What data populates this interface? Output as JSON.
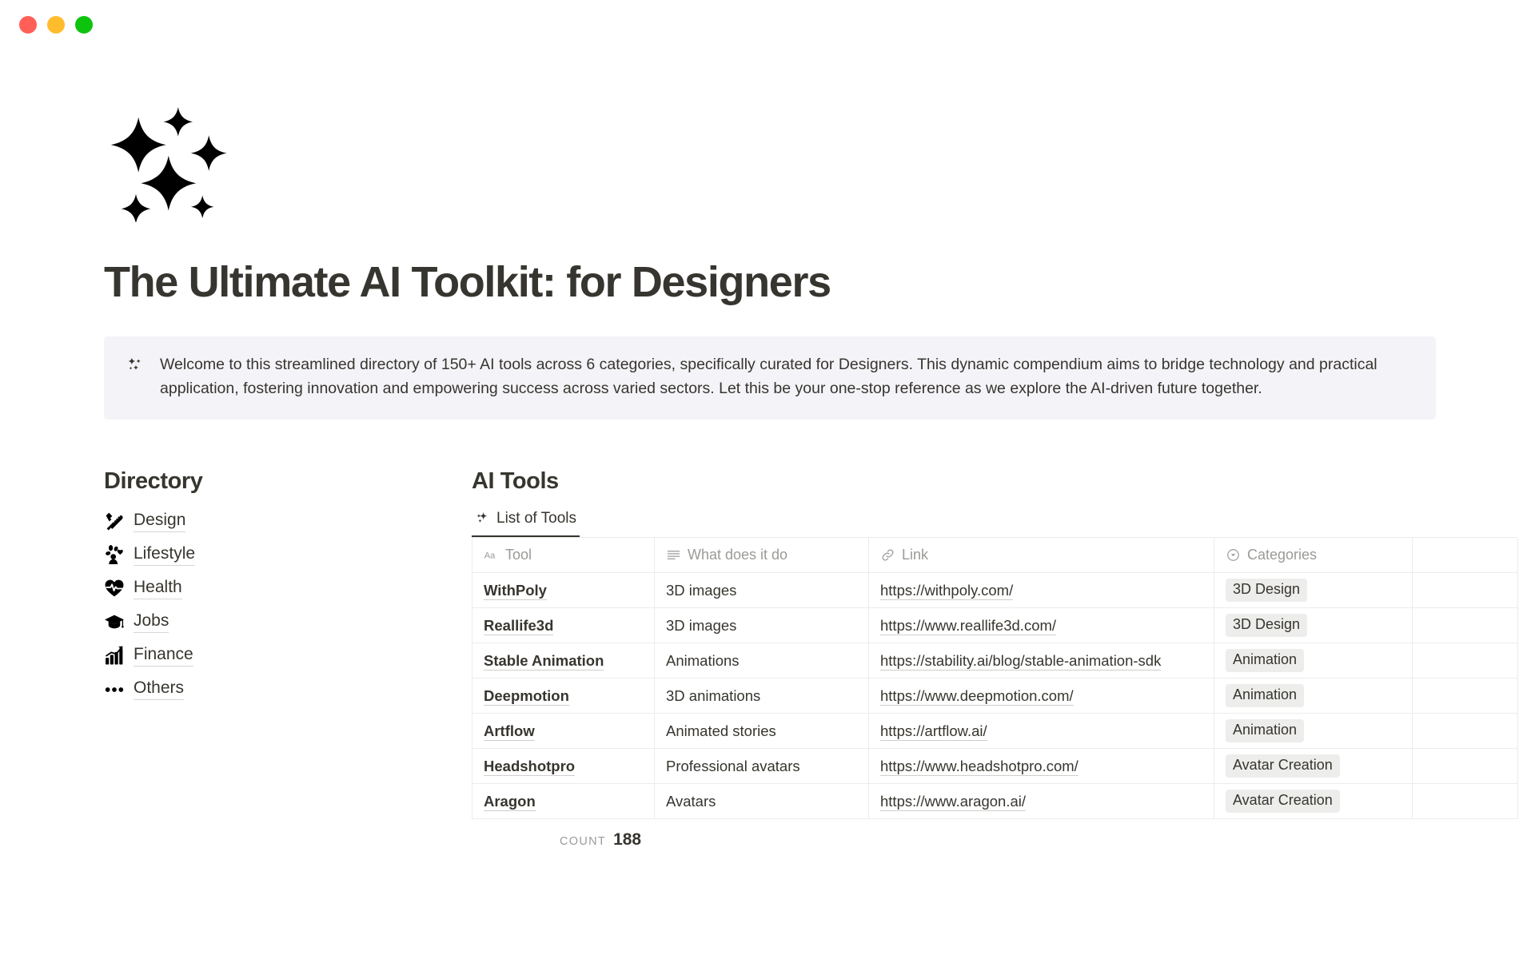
{
  "window": {
    "traffic_lights": [
      {
        "name": "close",
        "color": "#ff5f57"
      },
      {
        "name": "minimize",
        "color": "#ffbd2e"
      },
      {
        "name": "maximize",
        "color": "#0ec30e"
      }
    ]
  },
  "page": {
    "icon": "sparkles-emoji",
    "title": "The Ultimate AI Toolkit: for Designers"
  },
  "callout": {
    "icon": "sparkles-icon",
    "text": "Welcome to this streamlined directory of 150+ AI tools across 6 categories, specifically curated for Designers. This dynamic compendium aims to bridge technology and practical application, fostering innovation and empowering success across varied sectors. Let this be your one-stop reference as we explore the AI-driven future together."
  },
  "directory": {
    "title": "Directory",
    "items": [
      {
        "label": "Design",
        "icon": "triangular-ruler-icon"
      },
      {
        "label": "Lifestyle",
        "icon": "lifestyle-icon"
      },
      {
        "label": "Health",
        "icon": "heart-pulse-icon"
      },
      {
        "label": "Jobs",
        "icon": "graduation-cap-icon"
      },
      {
        "label": "Finance",
        "icon": "bar-chart-icon"
      },
      {
        "label": "Others",
        "icon": "ellipsis-icon"
      }
    ]
  },
  "tools": {
    "title": "AI Tools",
    "tabs": [
      {
        "label": "List of Tools",
        "icon": "sparkles-icon",
        "active": true
      }
    ],
    "columns": [
      {
        "label": "Tool",
        "icon": "title-aa-icon"
      },
      {
        "label": "What does it do",
        "icon": "text-lines-icon"
      },
      {
        "label": "Link",
        "icon": "link-chain-icon"
      },
      {
        "label": "Categories",
        "icon": "select-chevron-icon"
      },
      {
        "label": "",
        "icon": ""
      }
    ],
    "rows": [
      {
        "tool": "WithPoly",
        "what": "3D images",
        "link": "https://withpoly.com/",
        "category": "3D Design"
      },
      {
        "tool": "Reallife3d",
        "what": "3D images",
        "link": "https://www.reallife3d.com/",
        "category": "3D Design"
      },
      {
        "tool": "Stable Animation",
        "what": "Animations",
        "link": "https://stability.ai/blog/stable-animation-sdk",
        "category": "Animation"
      },
      {
        "tool": "Deepmotion",
        "what": "3D animations",
        "link": "https://www.deepmotion.com/",
        "category": "Animation"
      },
      {
        "tool": "Artflow",
        "what": "Animated stories",
        "link": "https://artflow.ai/",
        "category": "Animation"
      },
      {
        "tool": "Headshotpro",
        "what": "Professional avatars",
        "link": "https://www.headshotpro.com/",
        "category": "Avatar Creation"
      },
      {
        "tool": "Aragon",
        "what": "Avatars",
        "link": "https://www.aragon.ai/",
        "category": "Avatar Creation"
      }
    ],
    "footer": {
      "count_label": "COUNT",
      "count_value": "188"
    }
  },
  "colors": {
    "text": "#37352f",
    "muted": "#9b9a97",
    "callout_bg": "#f4f3f7",
    "tag_bg": "#ededec",
    "border": "#ececeb"
  }
}
